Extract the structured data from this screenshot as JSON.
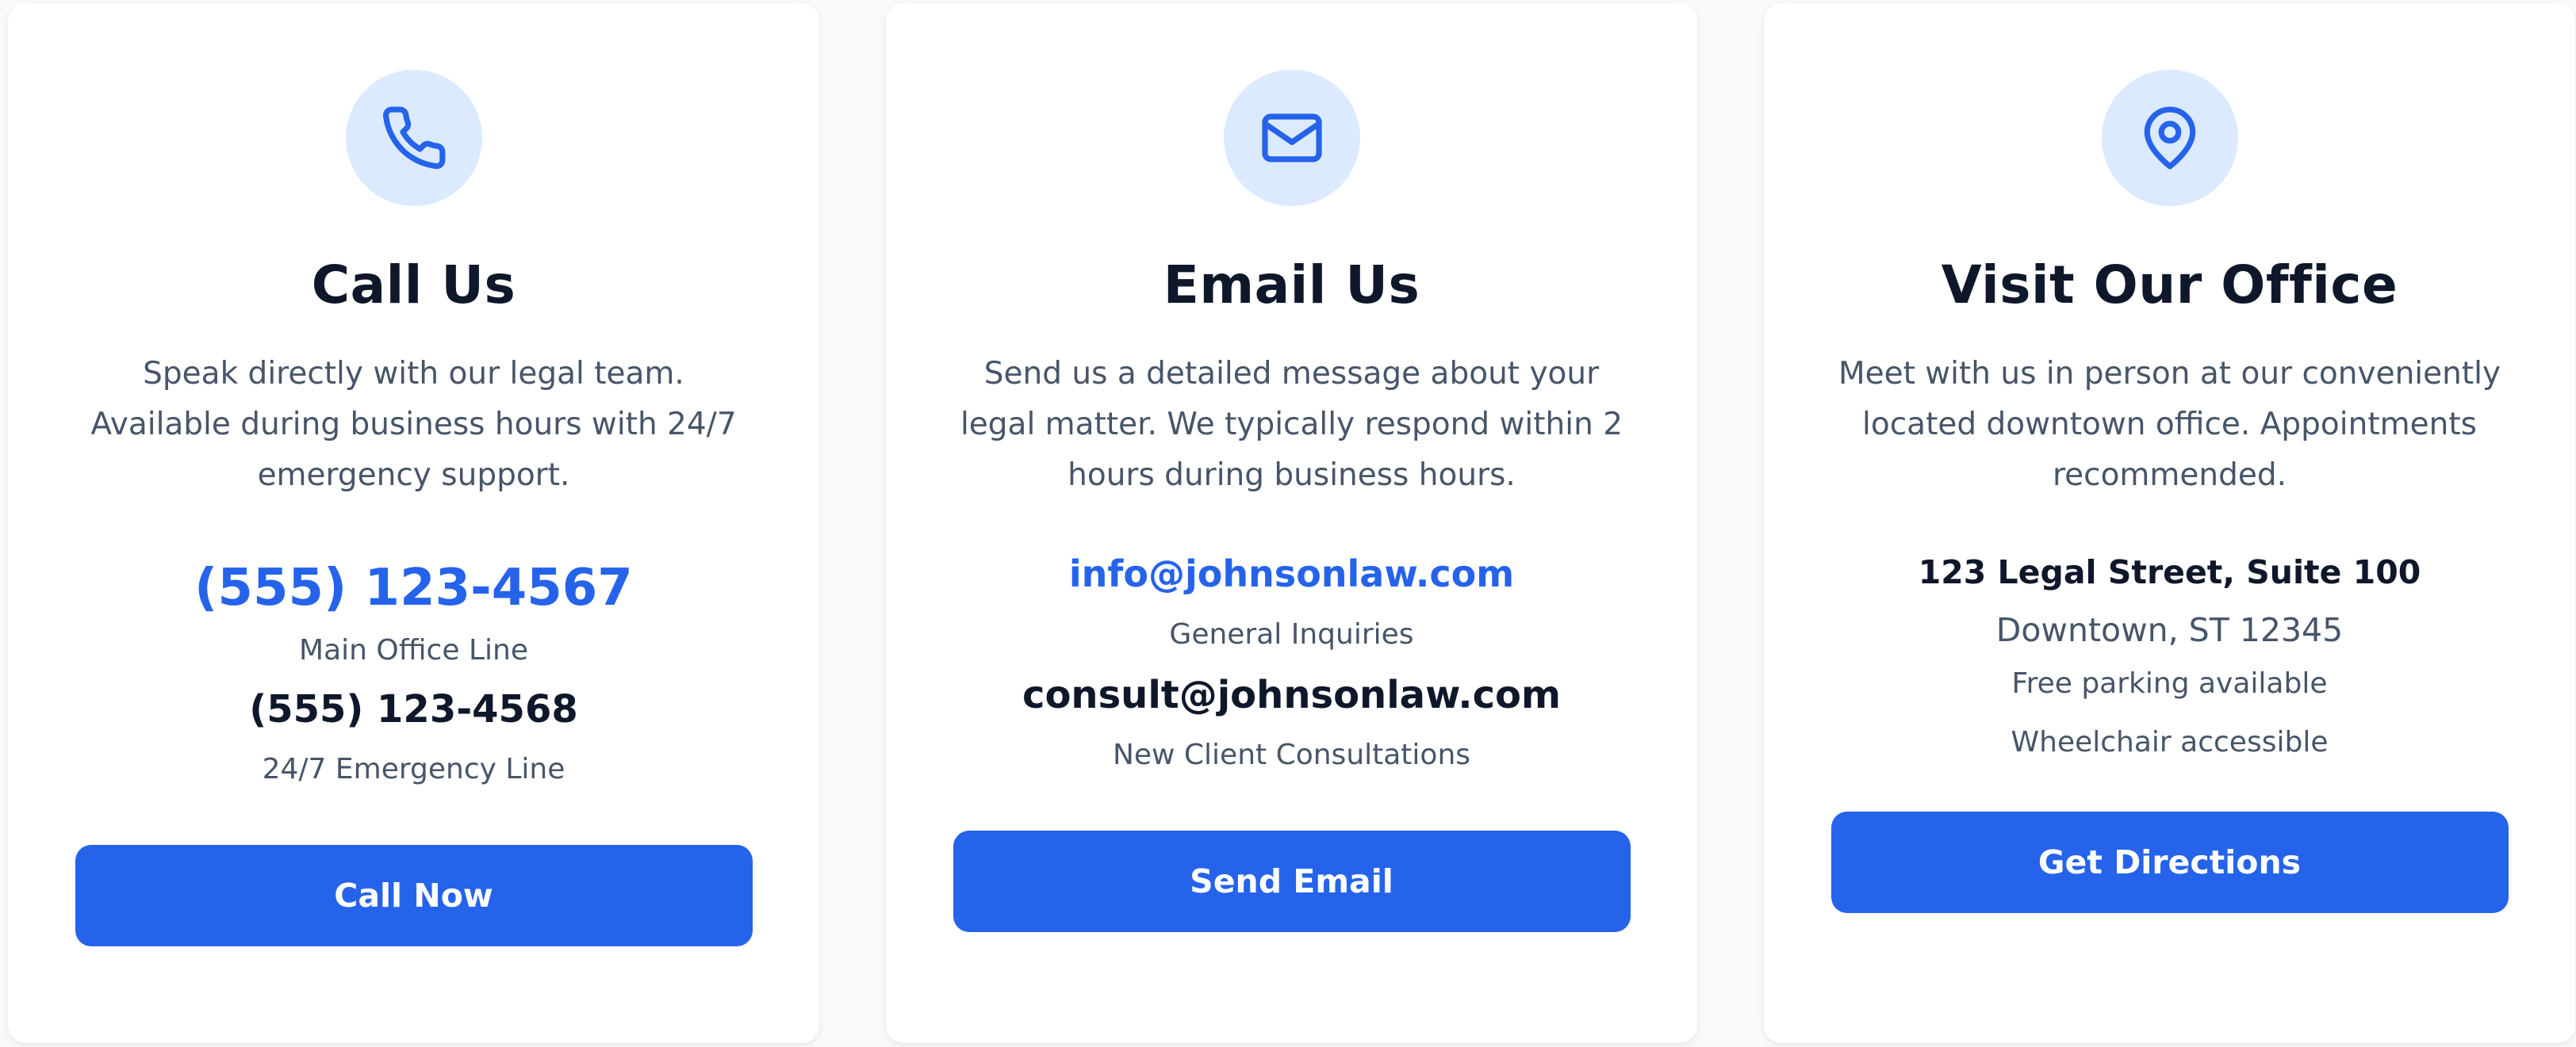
{
  "theme": {
    "accent": "#2563eb",
    "icon_bg": "#dbeafe",
    "title_color": "#0f172a",
    "muted_color": "#475569"
  },
  "cards": {
    "call": {
      "icon": "phone-icon",
      "title": "Call Us",
      "description": "Speak directly with our legal team.\nAvailable during business hours with 24/7\nemergency support.",
      "primary_contact": "(555) 123-4567",
      "primary_label": "Main Office Line",
      "secondary_contact": "(555) 123-4568",
      "secondary_label": "24/7 Emergency Line",
      "button_label": "Call Now"
    },
    "email": {
      "icon": "mail-icon",
      "title": "Email Us",
      "description": "Send us a detailed message about your\nlegal matter. We typically respond within 2\nhours during business hours.",
      "primary_contact": "info@johnsonlaw.com",
      "primary_label": "General Inquiries",
      "secondary_contact": "consult@johnsonlaw.com",
      "secondary_label": "New Client Consultations",
      "button_label": "Send Email"
    },
    "visit": {
      "icon": "map-pin-icon",
      "title": "Visit Our Office",
      "description": "Meet with us in person at our conveniently\nlocated downtown office. Appointments\nrecommended.",
      "address_line1": "123 Legal Street, Suite 100",
      "address_line2": "Downtown, ST 12345",
      "note1": "Free parking available",
      "note2": "Wheelchair accessible",
      "button_label": "Get Directions"
    }
  }
}
